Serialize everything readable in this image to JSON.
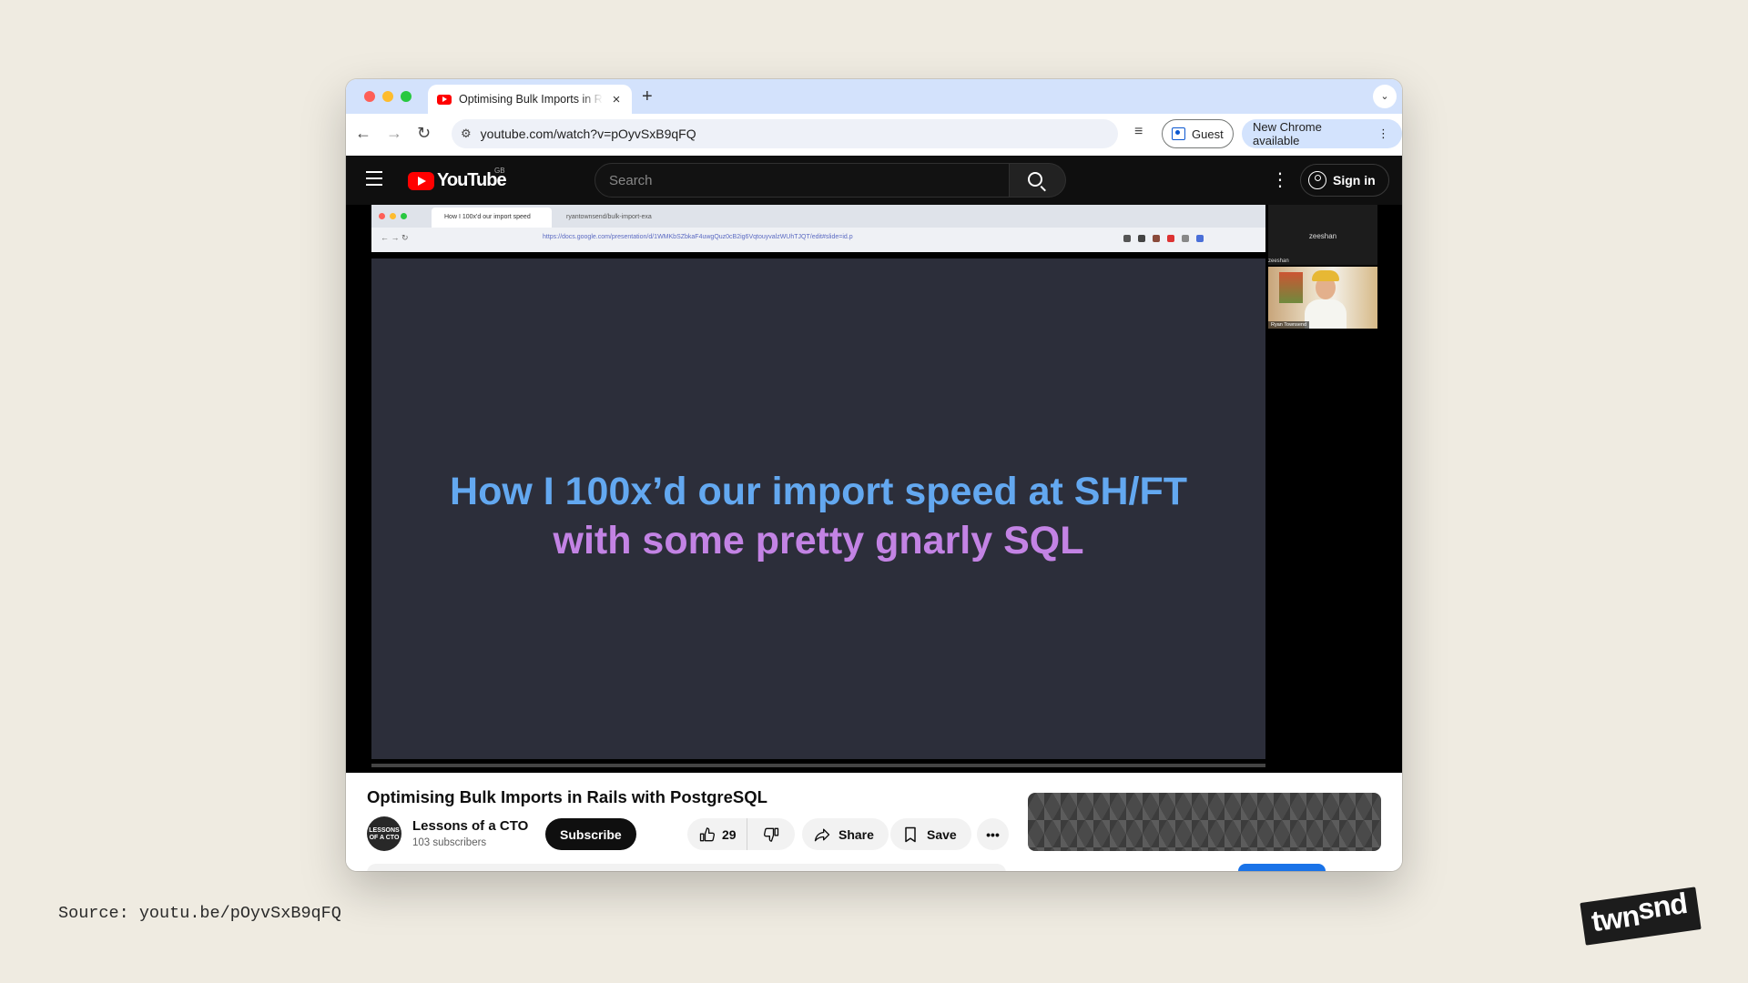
{
  "browser": {
    "tab_title": "Optimising Bulk Imports in Rails with PostgreSQL",
    "tab_close": "×",
    "new_tab": "+",
    "tab_menu": "⌄",
    "url": "youtube.com/watch?v=pOyvSxB9qFQ",
    "guest_label": "Guest",
    "update_label": "New Chrome available"
  },
  "youtube": {
    "logo_text": "YouTube",
    "region": "GB",
    "search_placeholder": "Search",
    "signin_label": "Sign in"
  },
  "player": {
    "inner_tab1": "How I 100x'd our import speed",
    "inner_tab2": "ryantownsend/bulk-import-exa",
    "inner_url": "https://docs.google.com/presentation/d/1WMKbSZbkaF4uwgQuz0cB2ig6VqtouyvalzWUhTJQT/edit#slide=id.p",
    "slide_line1": "How I 100x’d our import speed at SH/FT",
    "slide_line2": "with some pretty gnarly SQL",
    "participant_top": "zeeshan",
    "participant_label": "zeeshan",
    "webcam_label": "Ryan Townsend",
    "progress_fraction": 0.0
  },
  "video": {
    "title": "Optimising Bulk Imports in Rails with PostgreSQL",
    "channel_name": "Lessons of a CTO",
    "channel_avatar": "LESSONS OF A CTO",
    "subscribers": "103 subscribers",
    "subscribe_label": "Subscribe",
    "likes": "29",
    "share_label": "Share",
    "save_label": "Save"
  },
  "page": {
    "source": "Source: youtu.be/pOyvSxB9qFQ",
    "brand_part1": "twn",
    "brand_part2": "snd"
  },
  "colors": {
    "slide_bg": "#2c2e3a",
    "slide_line1": "#63a8f0",
    "slide_line2": "#c383e4",
    "youtube_red": "#ff0000",
    "page_bg": "#efebe1"
  }
}
